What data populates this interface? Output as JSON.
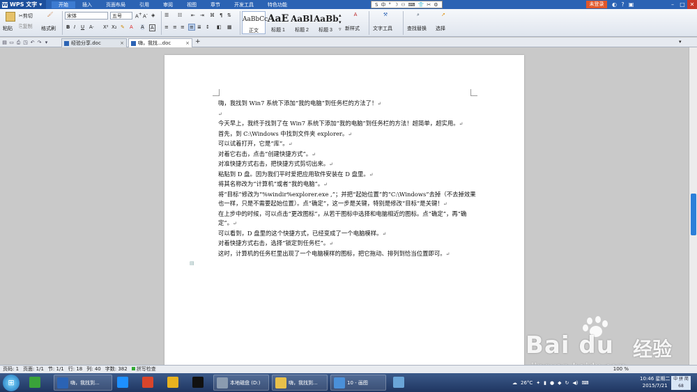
{
  "app": {
    "name": "WPS 文字",
    "menus": [
      "开始",
      "插入",
      "页面布局",
      "引用",
      "审阅",
      "视图",
      "章节",
      "开发工具",
      "特色功能"
    ],
    "active_menu": "开始",
    "login": "未登录",
    "ime_bar": [
      "S",
      "中",
      "°",
      "☽",
      "⚇",
      "⌨",
      "👕",
      "✂",
      "⚙"
    ]
  },
  "ribbon": {
    "paste": "粘贴",
    "cut": "剪切",
    "copy": "复制",
    "format_painter": "格式刷",
    "font": "宋体",
    "font_size": "五号",
    "style_normal_sample": "AaBbCc",
    "style_normal": "正文",
    "style_h1_sample": "AaE",
    "style_h1": "标题 1",
    "style_h2_sample": "AaBl",
    "style_h2": "标题 2",
    "style_h3_sample": "AaBb",
    "style_h3": "标题 3",
    "new_style": "新样式",
    "text_tools": "文字工具",
    "find_replace": "查找替换",
    "select": "选择"
  },
  "tabs": [
    {
      "label": "经验分享.doc",
      "active": false
    },
    {
      "label": "嗨，我找...doc",
      "active": true
    }
  ],
  "document": {
    "paragraphs": [
      "嗨，我找到 Win7 系统下添加“我的电脑”到任务栏的方法了！",
      "",
      "今天早上，我终于找到了在 Win7 系统下添加“我的电脑”到任务栏的方法！超简单，超实用。",
      "首先，到 C:\\Windows 中找到文件夹 explorer。",
      "可以试着打开，它是“库”。",
      "对着它右击，点击“创建快捷方式”。",
      "对准快捷方式右击，把快捷方式剪切出来。",
      "粘贴到 D 盘。因为我们平时爱把应用软件安装在 D 盘里。",
      "将其名称改为“计算机”或者“我的电脑”。",
      "将“目标”修改为“%windir%explorer.exe ,”；并把“起始位置”的“C:\\Windows”去掉（不去掉效果也一样，只是不需要起始位置）。点“确定”，这一步是关键，特别是修改“目标”是关键！",
      "在上步中的时候，可以点击“更改图标”，从若干图标中选择和电脑相近的图标。点“确定”，再“确定”。",
      "可以看到，D 盘里的这个快捷方式，已经变成了一个电脑模样。",
      "对着快捷方式右击，选择“锁定到任务栏”。",
      "这时，计算机的任务栏里出现了一个电脑模样的图标，把它拖动、排列到恰当位置即可。"
    ],
    "para_mark": "↵"
  },
  "status": {
    "page": "页码: 1",
    "pages": "页面: 1/1",
    "section": "节: 1/1",
    "row": "行: 18",
    "col": "列: 40",
    "words": "字数: 382",
    "spell": "拼写检查",
    "zoom": "100 %"
  },
  "taskbar": {
    "items": [
      {
        "label": "",
        "color": "#3aa23a"
      },
      {
        "label": "嗨，我找到...",
        "color": "#2b63b4"
      },
      {
        "label": "",
        "color": "#1e90ff"
      },
      {
        "label": "",
        "color": "#d9452b"
      },
      {
        "label": "",
        "color": "#e8b21f"
      },
      {
        "label": "",
        "color": "#111111"
      },
      {
        "label": "本地磁盘 (D:)",
        "color": "#8a9bb0"
      },
      {
        "label": "嗨，我找到...",
        "color": "#e8c04a"
      },
      {
        "label": "10 - 画图",
        "color": "#4a90d9"
      },
      {
        "label": "",
        "color": "#6aa5d8"
      }
    ],
    "weather": "26°C",
    "time": "10:46 星期二",
    "date": "2015/7/21",
    "ime_badge_top": "中 拼 简",
    "ime_badge_bottom": "68"
  },
  "watermark": {
    "brand": "Bai du",
    "cn": "经验",
    "url": "jingyan.baidu.com"
  }
}
